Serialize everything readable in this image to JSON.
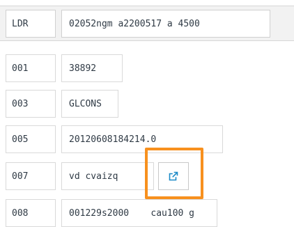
{
  "record": {
    "fields": [
      {
        "tag": "LDR",
        "value": "02052ngm a2200517 a 4500"
      },
      {
        "tag": "001",
        "value": "38892"
      },
      {
        "tag": "003",
        "value": "GLCONS"
      },
      {
        "tag": "005",
        "value": "20120608184214.0"
      },
      {
        "tag": "007",
        "value": "vd cvaizq"
      },
      {
        "tag": "008",
        "value": "001229s2000    cau100 g"
      }
    ]
  },
  "icons": {
    "external_link": "external-link-icon"
  },
  "colors": {
    "highlight": "#f7901e",
    "icon": "#1b8ac7",
    "ldr_background": "#f2f2f2",
    "cell_border": "#d9d9d9"
  }
}
